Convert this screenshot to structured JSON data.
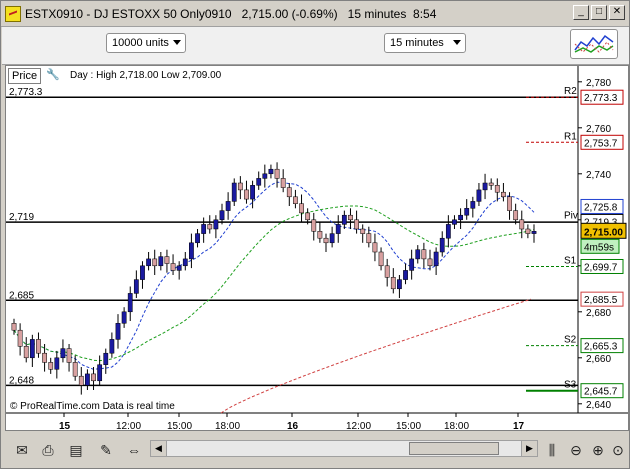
{
  "window": {
    "title": "ESTX0910 - DJ ESTOXX 50 Only0910",
    "last_price": "2,715.00 (-0.69%)",
    "interval": "15 minutes",
    "time": "8:54",
    "minimize": "_",
    "maximize": "□",
    "close": "✕"
  },
  "toolbar": {
    "units_select": "10000 units",
    "interval_select": "15 minutes"
  },
  "chart": {
    "price_tab": "Price",
    "day_info": "Day : High 2,718.00 Low 2,709.00",
    "footer_note": "© ProRealTime.com  Data is real time",
    "current_price_tag": "2,715.00",
    "countdown_tag": "4m59s",
    "colors": {
      "up_candle": "#1a1aa0",
      "down_candle": "#d8a0a0",
      "resistance": "#c00000",
      "support": "#008000",
      "ma_blue": "#2040d0",
      "ma_green": "#20a020",
      "ma_red": "#d04040"
    }
  },
  "chart_data": {
    "type": "candlestick",
    "title": "ESTX0910 - DJ ESTOXX 50 Only0910",
    "y_axis": {
      "ticks": [
        "2,780",
        "2,760",
        "2,740",
        "2,720",
        "2,700",
        "2,680",
        "2,660",
        "2,640"
      ],
      "range": [
        2636,
        2786
      ]
    },
    "x_axis": {
      "ticks": [
        "15",
        "12:00",
        "15:00",
        "18:00",
        "16",
        "12:00",
        "15:00",
        "18:00",
        "17"
      ]
    },
    "horizontal_lines": [
      {
        "label": "2,773.3",
        "value": 2773.3
      },
      {
        "label": "2,719",
        "value": 2719
      },
      {
        "label": "2,685",
        "value": 2685
      },
      {
        "label": "2,648",
        "value": 2648
      }
    ],
    "pivot_levels": [
      {
        "name": "R2",
        "value": 2773.3,
        "tag": "2,773.3"
      },
      {
        "name": "R1",
        "value": 2753.7,
        "tag": "2,753.7"
      },
      {
        "name": "Piv",
        "value": 2719.3,
        "tag": "2,719.3"
      },
      {
        "name": "S1",
        "value": 2699.7,
        "tag": "2,699.7"
      },
      {
        "name": "S2",
        "value": 2665.3,
        "tag": "2,665.3"
      },
      {
        "name": "S3",
        "value": 2645.7,
        "tag": "2,645.7"
      }
    ],
    "right_tags": [
      {
        "value": 2725.8,
        "tag": "2,725.8"
      },
      {
        "value": 2685.5,
        "tag": "2,685.5"
      }
    ],
    "closes": [
      2672,
      2665,
      2660,
      2668,
      2662,
      2658,
      2655,
      2660,
      2664,
      2658,
      2652,
      2648,
      2653,
      2650,
      2657,
      2662,
      2668,
      2675,
      2680,
      2688,
      2694,
      2700,
      2703,
      2700,
      2704,
      2701,
      2698,
      2700,
      2703,
      2710,
      2714,
      2718,
      2716,
      2720,
      2724,
      2728,
      2736,
      2733,
      2729,
      2735,
      2738,
      2740,
      2742,
      2738,
      2734,
      2730,
      2727,
      2723,
      2720,
      2715,
      2712,
      2710,
      2714,
      2718,
      2722,
      2720,
      2716,
      2714,
      2710,
      2706,
      2700,
      2695,
      2690,
      2694,
      2698,
      2703,
      2707,
      2703,
      2700,
      2706,
      2712,
      2718,
      2720,
      2722,
      2725,
      2728,
      2733,
      2736,
      2735,
      2732,
      2730,
      2724,
      2720,
      2716,
      2714,
      2715
    ]
  },
  "bottom": {
    "scroll_left": "◀",
    "scroll_right": "▶",
    "icons": [
      "mail-icon",
      "print-icon",
      "export-icon",
      "drawing-icon"
    ]
  }
}
